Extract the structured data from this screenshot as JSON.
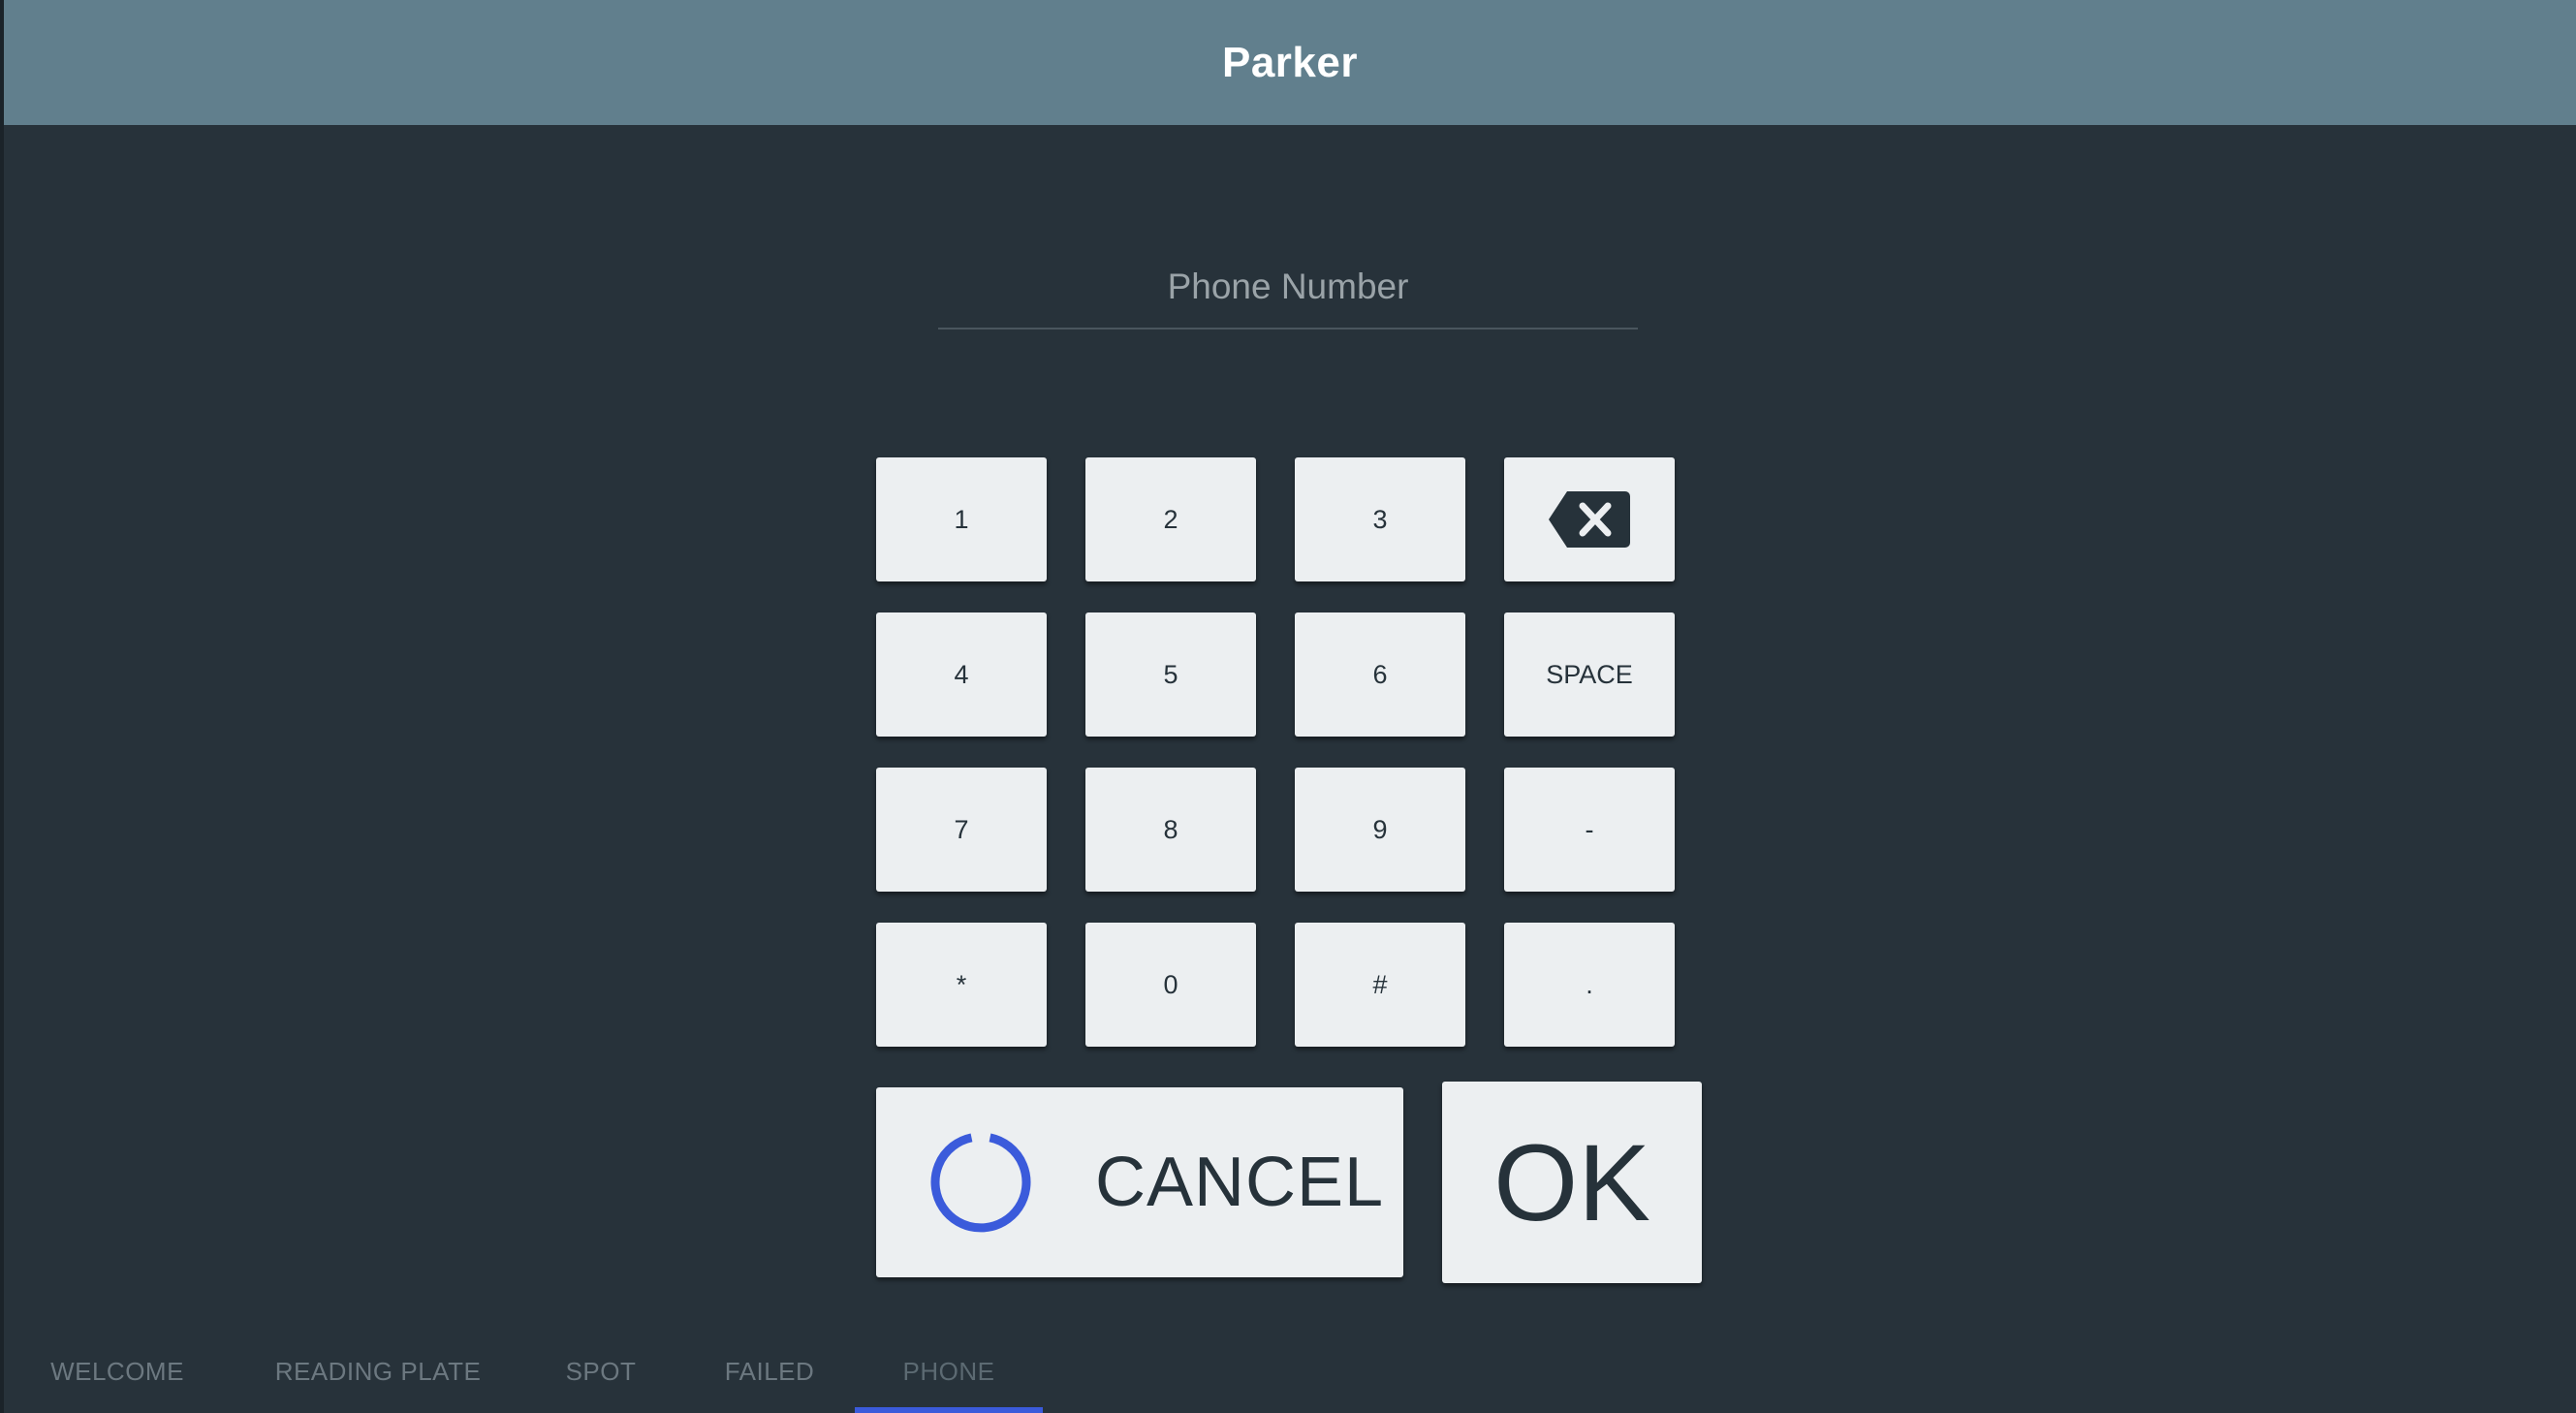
{
  "app": {
    "title": "Parker"
  },
  "phone": {
    "placeholder": "Phone Number",
    "value": ""
  },
  "keypad": {
    "keys": [
      "1",
      "2",
      "3",
      "4",
      "5",
      "6",
      "SPACE",
      "7",
      "8",
      "9",
      "-",
      "*",
      "0",
      "#",
      "."
    ],
    "backspace_icon": "backspace-icon"
  },
  "actions": {
    "cancel_label": "CANCEL",
    "ok_label": "OK",
    "cancel_icon": "loading-spinner-icon"
  },
  "tabs": [
    {
      "label": "WELCOME"
    },
    {
      "label": "READING PLATE"
    },
    {
      "label": "SPOT"
    },
    {
      "label": "FAILED"
    },
    {
      "label": "PHONE",
      "active": true
    }
  ],
  "colors": {
    "background": "#27323a",
    "titlebar": "#617f8d",
    "key": "#eceff1",
    "accent": "#3b5bdb"
  }
}
